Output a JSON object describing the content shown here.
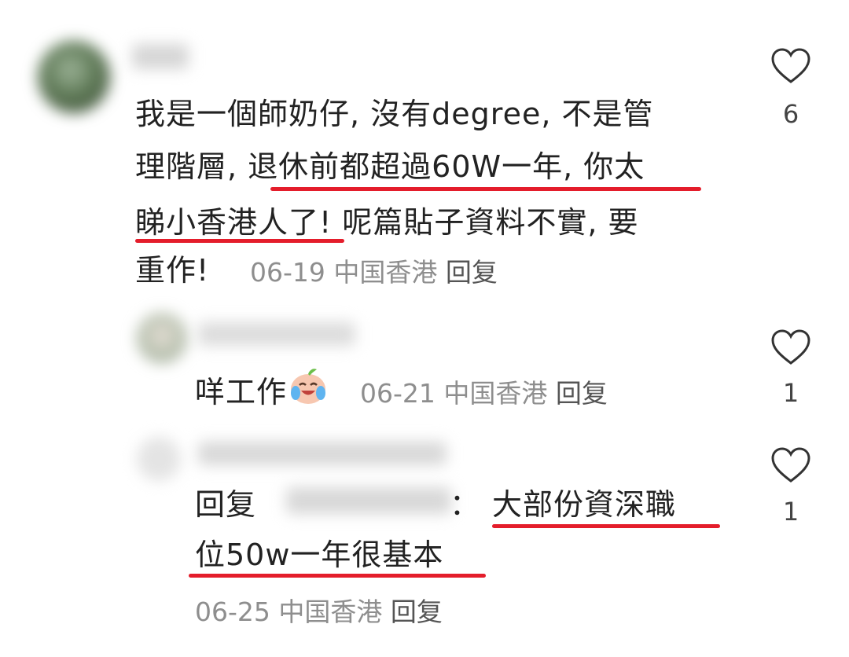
{
  "comment1": {
    "text_lines": [
      "我是一個師奶仔, 沒有degree, 不是管",
      "理階層, 退休前都超過60W一年, 你太",
      "睇小香港人了! 呢篇貼子資料不實, 要",
      "重作!"
    ],
    "date": "06-19",
    "location": "中国香港",
    "reply_label": "回复",
    "like_count": "6"
  },
  "reply1": {
    "text": "咩工作",
    "emoji": "crying-laughing-peach",
    "date": "06-21",
    "location": "中国香港",
    "reply_label": "回复",
    "like_count": "1"
  },
  "reply2": {
    "prefix": "回复",
    "colon": "：",
    "text_line1": "大部份資深職",
    "text_line2": "位50w一年很基本",
    "date": "06-25",
    "location": "中国香港",
    "reply_label": "回复",
    "like_count": "1"
  },
  "colors": {
    "underline": "#e41d2b",
    "meta": "#8e8e8e",
    "text": "#222222"
  }
}
